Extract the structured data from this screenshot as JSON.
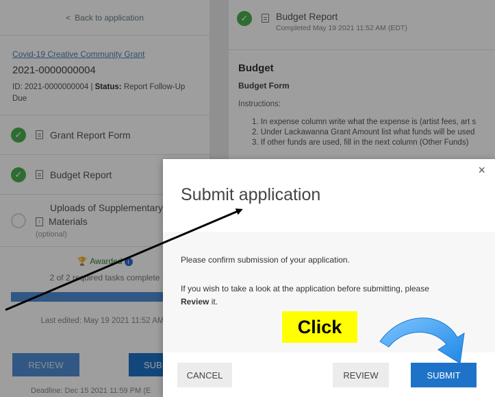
{
  "sidebar": {
    "back_label": "Back to application",
    "grant_name": "Covid-19 Creative Community Grant",
    "grant_number": "2021-0000000004",
    "id_label": "ID: 2021-0000000004 | ",
    "status_key": "Status:",
    "status_value": " Report Follow-Up Due",
    "tasks": [
      {
        "label": "Grant Report Form",
        "state": "completed"
      },
      {
        "label": "Budget Report",
        "state": "completed"
      },
      {
        "label": "Uploads of Supplementary",
        "label2": "Materials",
        "sub": "(optional)",
        "state": "pending"
      }
    ],
    "awarded_label": "Awarded",
    "progress_text": "2 of 2 required tasks complete",
    "progress_fraction": 1.0,
    "last_edited": "Last edited: May 19 2021 11:52 AM (",
    "review_label": "REVIEW",
    "submit_label": "SUB",
    "deadline": "Deadline: Dec 15 2021 11:59 PM (E"
  },
  "main": {
    "report_title": "Budget Report",
    "report_completed": "Completed May 19 2021 11:52 AM (EDT)",
    "heading": "Budget",
    "form_title": "Budget Form",
    "instructions_label": "Instructions:",
    "instructions": [
      "1. In expense column write what the expense is (artist fees, art s",
      "2. Under Lackawanna Grant Amount list what funds will be used",
      "3. If other funds are used, fill in the next column (Other Funds)"
    ]
  },
  "modal": {
    "close_glyph": "×",
    "title": "Submit application",
    "confirm_text": "Please confirm submission of your application.",
    "wish_text_1": "If you wish to take a look at the application before submitting, please ",
    "wish_text_bold": "Review",
    "wish_text_2": " it.",
    "cancel_label": "CANCEL",
    "review_label": "REVIEW",
    "submit_label": "SUBMIT"
  },
  "annotation": {
    "click_label": "Click",
    "label_color": "#ffff00",
    "arrow_color": "#2f8fe8"
  },
  "colors": {
    "primary": "#1e73c8",
    "success": "#4caf50",
    "link": "#4a7fb3"
  }
}
